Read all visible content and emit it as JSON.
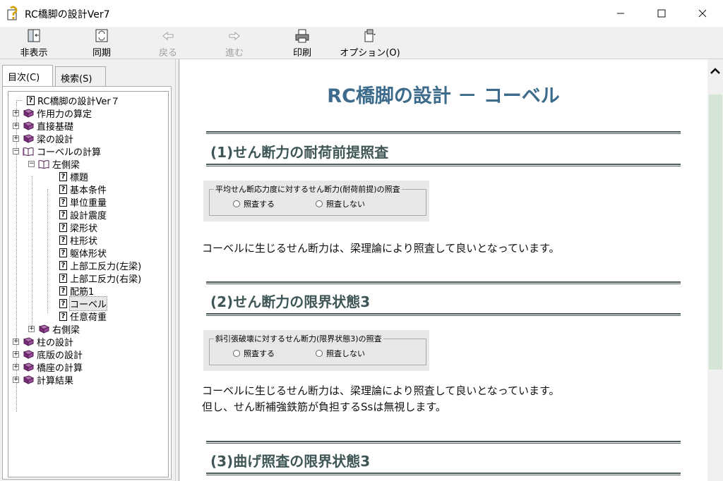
{
  "window": {
    "title": "RC橋脚の設計Ver7"
  },
  "toolbar": {
    "hide": "非表示",
    "sync": "同期",
    "back": "戻る",
    "forward": "進む",
    "print": "印刷",
    "options": "オプション(O)"
  },
  "tabs": {
    "contents": "目次(C)",
    "search": "検索(S)"
  },
  "tree": {
    "root": "RC橋脚の設計Ver７",
    "n1": "作用力の算定",
    "n2": "直接基礎",
    "n3": "梁の設計",
    "n4": "コーベルの計算",
    "n4a": "左側梁",
    "p1": "標題",
    "p2": "基本条件",
    "p3": "単位重量",
    "p4": "設計震度",
    "p5": "梁形状",
    "p6": "柱形状",
    "p7": "躯体形状",
    "p8": "上部工反力(左梁)",
    "p9": "上部工反力(右梁)",
    "p10": "配筋1",
    "p11": "コーベル",
    "p12": "任意荷重",
    "n4b": "右側梁",
    "n5": "柱の設計",
    "n6": "底版の設計",
    "n7": "橋座の計算",
    "n8": "計算結果"
  },
  "content": {
    "title": "RC橋脚の設計 － コーベル",
    "s1": {
      "heading": "(1)せん断力の耐荷前提照査",
      "group": "平均せん断応力度に対するせん断力(耐荷前提)の照査",
      "opt1": "照査する",
      "opt2": "照査しない",
      "text": "コーベルに生じるせん断力は、梁理論により照査して良いとなっています。"
    },
    "s2": {
      "heading": "(2)せん断力の限界状態3",
      "group": "斜引張破壊に対するせん断力(限界状態3)の照査",
      "opt1": "照査する",
      "opt2": "照査しない",
      "text1": "コーベルに生じるせん断力は、梁理論により照査して良いとなっています。",
      "text2": "但し、せん断補強鉄筋が負担するSsは無視します。"
    },
    "s3": {
      "heading": "(3)曲げ照査の限界状態3"
    }
  },
  "colors": {
    "title": "#3d6b8c",
    "section": "#3f5656",
    "scroll_thumb": "#d5e5d5"
  }
}
